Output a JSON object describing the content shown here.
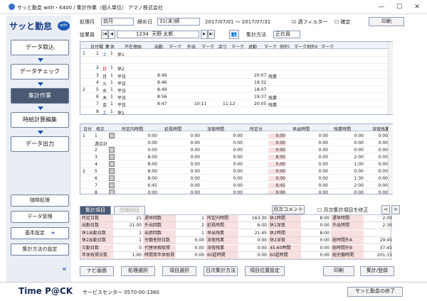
{
  "window": {
    "title": "サッと勤怠 with・K400 / 集計作業（個人単位） アマノ株式会社",
    "minimize": "—",
    "maximize": "☐",
    "close": "✕"
  },
  "sidebar": {
    "brand": "サッと勤怠",
    "brand_badge": "with",
    "nav": [
      "データ取込",
      "データチェック",
      "集計作業",
      "時給計算編集",
      "データ出力"
    ],
    "sub": [
      "随時処理",
      "データ管理",
      "基本設定",
      "集計方法の設定"
    ],
    "back": "«"
  },
  "toolbar": {
    "period_label": "処理月",
    "period_value": "前月",
    "cutoff_label": "締め日",
    "cutoff_value": "31(末)締",
    "range": "2017/07/01 ～ 2017/07/31",
    "week_filter": "週フィルター",
    "confirm": "確定",
    "print": "印刷",
    "emp_label": "従業員",
    "emp_code": "1234",
    "emp_name": "天野 太郎",
    "method_label": "集計方法",
    "method_value": "正社員"
  },
  "daily": {
    "headers": [
      "日付",
      "曜",
      "集",
      "休",
      "不在理由",
      "出勤",
      "マーク",
      "外出",
      "マーク",
      "戻り",
      "マーク",
      "退勤",
      "マーク",
      "例外Ⅰ",
      "マーク",
      "例外Ⅱ",
      "マーク"
    ],
    "rows": [
      {
        "w": "1",
        "d": "1",
        "y": "土",
        "s": "1",
        "k": "休1",
        "in": "",
        "out1": "",
        "back": "",
        "leave": "",
        "note": ""
      },
      {
        "w": "",
        "d": "",
        "y": "",
        "s": "",
        "k": "",
        "in": "",
        "out1": "",
        "back": "",
        "leave": "",
        "note": ""
      },
      {
        "w": "",
        "d": "2",
        "y": "日",
        "s": "1",
        "k": "休2",
        "in": "",
        "out1": "",
        "back": "",
        "leave": "",
        "note": ""
      },
      {
        "w": "",
        "d": "3",
        "y": "月",
        "s": "1",
        "k": "平日",
        "in": "8:49",
        "out1": "",
        "back": "",
        "leave": "20:07",
        "note": "残業"
      },
      {
        "w": "",
        "d": "4",
        "y": "火",
        "s": "1",
        "k": "平日",
        "in": "8:46",
        "out1": "",
        "back": "",
        "leave": "19:32",
        "note": ""
      },
      {
        "w": "2",
        "d": "5",
        "y": "水",
        "s": "1",
        "k": "平日",
        "in": "8:49",
        "out1": "",
        "back": "",
        "leave": "18:07",
        "note": ""
      },
      {
        "w": "",
        "d": "6",
        "y": "木",
        "s": "1",
        "k": "平日",
        "in": "8:56",
        "out1": "",
        "back": "",
        "leave": "19:37",
        "note": "残業"
      },
      {
        "w": "",
        "d": "7",
        "y": "金",
        "s": "1",
        "k": "平日",
        "in": "8:47",
        "out1": "10:11",
        "back": "11:12",
        "leave": "20:05",
        "note": "残業"
      },
      {
        "w": "",
        "d": "8",
        "y": "土",
        "s": "1",
        "k": "休1",
        "in": "",
        "out1": "",
        "back": "",
        "leave": "",
        "note": ""
      }
    ]
  },
  "calc": {
    "headers": [
      "日付",
      "修正",
      "所定内時間",
      "延長時間",
      "深夜時間",
      "所定分",
      "早出時間",
      "残業時間",
      "深夜残業",
      "休日"
    ],
    "rows": [
      {
        "w": "1",
        "d": "1",
        "v": [
          "0:00",
          "0:00",
          "0:00",
          "0:00",
          "0:00",
          "0:00",
          "0:00"
        ]
      },
      {
        "w": "",
        "d": "週合計",
        "v": [
          "0:00",
          "0:00",
          "0:00",
          "0:00",
          "0:00",
          "0:00",
          "0:00"
        ]
      },
      {
        "w": "",
        "d": "2",
        "v": [
          "0:00",
          "0:00",
          "0:00",
          "0:00",
          "0:00",
          "0:00",
          "0:00"
        ]
      },
      {
        "w": "",
        "d": "3",
        "v": [
          "8:00",
          "0:00",
          "0:00",
          "8:00",
          "0:00",
          "2:00",
          "0:00"
        ]
      },
      {
        "w": "",
        "d": "4",
        "v": [
          "8:00",
          "0:00",
          "0:00",
          "0:00",
          "0:00",
          "1:00",
          "0:00"
        ]
      },
      {
        "w": "2",
        "d": "5",
        "v": [
          "8:00",
          "0:00",
          "0:00",
          "0:00",
          "0:00",
          "0:00",
          "0:00"
        ]
      },
      {
        "w": "",
        "d": "6",
        "v": [
          "8:00",
          "0:00",
          "0:00",
          "0:00",
          "0:00",
          "1:30",
          "0:00"
        ]
      },
      {
        "w": "",
        "d": "7",
        "v": [
          "6:45",
          "0:00",
          "0:00",
          "6:45",
          "0:00",
          "2:00",
          "0:00"
        ]
      },
      {
        "w": "",
        "d": "8",
        "v": [
          "0:00",
          "0:00",
          "0:00",
          "0:00",
          "0:00",
          "0:00",
          "0:00"
        ]
      }
    ]
  },
  "summary": {
    "tab1": "集計項目",
    "tab2": "詳細項目",
    "comment_btn": "月次コメント",
    "correct_label": "月次集計項目を修正",
    "prev": "<",
    "next": ">",
    "cols": [
      [
        {
          "k": "所定日数",
          "v": "21"
        },
        {
          "k": "出勤日数",
          "v": "21.00"
        },
        {
          "k": "休1出勤日数",
          "v": "1"
        },
        {
          "k": "休2出勤日数",
          "v": "1"
        },
        {
          "k": "欠勤日数",
          "v": "0"
        },
        {
          "k": "年休取得日数",
          "v": "1.00"
        }
      ],
      [
        {
          "k": "遅早回数",
          "v": "1"
        },
        {
          "k": "外出回数",
          "v": "2"
        },
        {
          "k": "出張回数",
          "v": "1"
        },
        {
          "k": "労働免除日数",
          "v": "0.00"
        },
        {
          "k": "代替休暇取得",
          "v": "0.00"
        },
        {
          "k": "時間単年休取得",
          "v": "0:00"
        }
      ],
      [
        {
          "k": "所定内時間",
          "v": "163:30"
        },
        {
          "k": "延長時間",
          "v": "6:00"
        },
        {
          "k": "早出残業",
          "v": "21:45"
        },
        {
          "k": "深夜残業",
          "v": "0:00"
        },
        {
          "k": "深夜残業",
          "v": "0:00"
        },
        {
          "k": "60超時間",
          "v": "0:00"
        }
      ],
      [
        {
          "k": "休1時間",
          "v": "8:00"
        },
        {
          "k": "休1深夜",
          "v": "0:00"
        },
        {
          "k": "休2時間",
          "v": "8:00"
        },
        {
          "k": "休2深夜",
          "v": "0:00"
        },
        {
          "k": "45-60時間",
          "v": "0:00"
        },
        {
          "k": "60超時間",
          "v": "0:00"
        }
      ],
      [
        {
          "k": "遅早時間",
          "v": "2:00"
        },
        {
          "k": "外出時間",
          "v": "2:30"
        },
        {
          "k": "",
          "v": ""
        },
        {
          "k": "総時間外A",
          "v": "29:45"
        },
        {
          "k": "総時間外B",
          "v": "37:45"
        },
        {
          "k": "総労働時間",
          "v": "201:15"
        }
      ]
    ]
  },
  "actions": [
    "ナビ画面",
    "処理選択",
    "項目選択",
    "日次集計方法",
    "項目位置設定",
    "印刷",
    "集計/登録"
  ],
  "footer": {
    "logo": "Time P@CK",
    "service": "サービスセンター 0570-00-1360",
    "exit": "サッと勤怠の終了"
  }
}
